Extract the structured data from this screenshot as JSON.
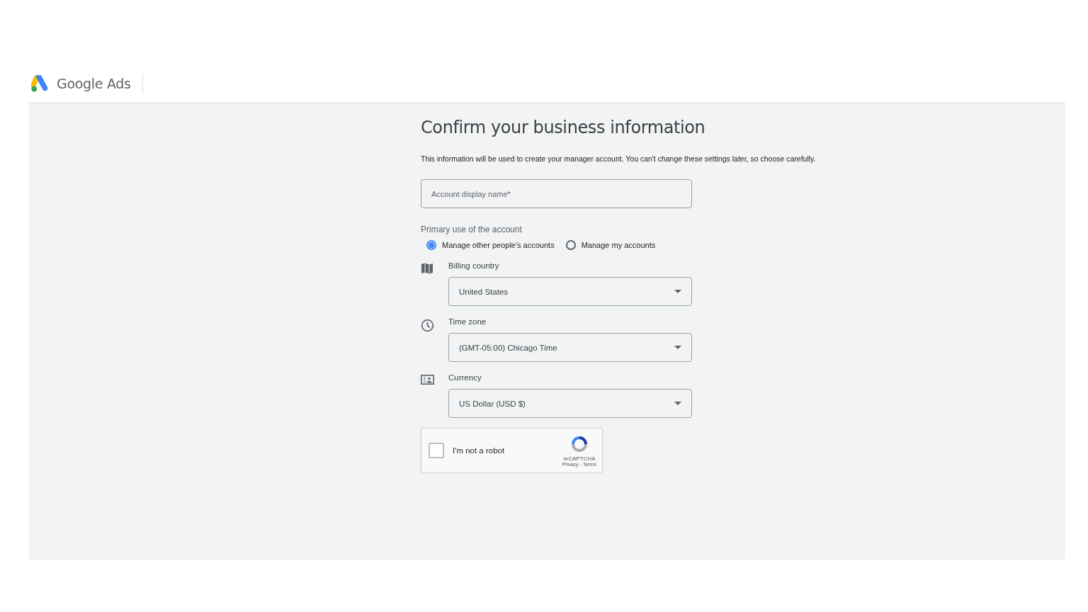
{
  "header": {
    "product": "Google Ads"
  },
  "form": {
    "title": "Confirm your business information",
    "description": "This information will be used to create your manager account. You can't change these settings later, so choose carefully.",
    "name_field": {
      "placeholder": "Account display name*"
    },
    "primary_use": {
      "label": "Primary use of the account",
      "options": [
        {
          "label": "Manage other people's accounts",
          "selected": true
        },
        {
          "label": "Manage my accounts",
          "selected": false
        }
      ]
    },
    "selects": [
      {
        "kind": "map",
        "label": "Billing country",
        "value": "United States"
      },
      {
        "kind": "clock",
        "label": "Time zone",
        "value": "(GMT-05:00) Chicago Time"
      },
      {
        "kind": "currency",
        "label": "Currency",
        "value": "US Dollar (USD $)"
      }
    ],
    "recaptcha": {
      "label": "I'm not a robot",
      "checked": false,
      "brand": "reCAPTCHA",
      "links": [
        "Privacy",
        "Terms"
      ],
      "separator": "-"
    }
  }
}
